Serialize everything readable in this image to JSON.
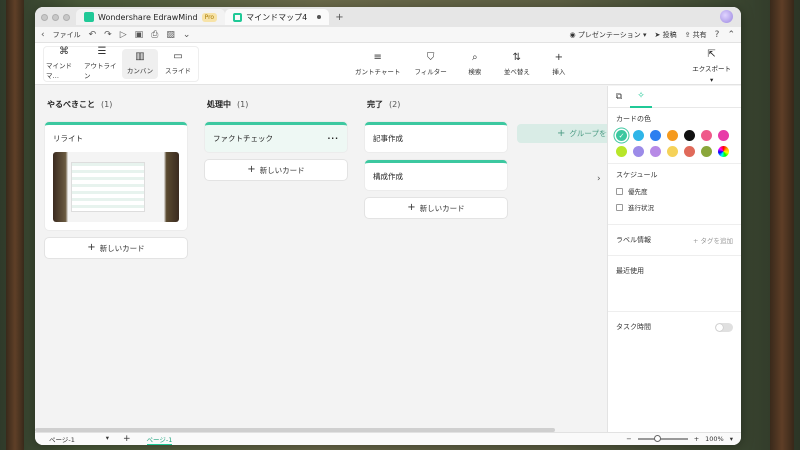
{
  "window": {
    "tabs": [
      {
        "label": "Wondershare EdrawMind",
        "badge": "Pro"
      },
      {
        "label": "マインドマップ4"
      }
    ]
  },
  "menubar": {
    "file_label": "ファイル",
    "present_label": "プレゼンテーション",
    "post_label": "投稿",
    "share_label": "共有"
  },
  "toolbar": {
    "views": [
      {
        "label": "マインドマ…",
        "icon": "mindmap-icon"
      },
      {
        "label": "アウトライン",
        "icon": "outline-icon"
      },
      {
        "label": "カンバン",
        "icon": "kanban-icon"
      },
      {
        "label": "スライド",
        "icon": "slide-icon"
      }
    ],
    "tools": [
      {
        "label": "ガントチャート"
      },
      {
        "label": "フィルター"
      },
      {
        "label": "検索"
      },
      {
        "label": "並べ替え"
      },
      {
        "label": "挿入"
      }
    ],
    "export_label": "エクスポート"
  },
  "board": {
    "columns": [
      {
        "title": "やるべきこと",
        "count": "(1)",
        "cards": [
          "リライト"
        ]
      },
      {
        "title": "処理中",
        "count": "(1)",
        "cards": [
          "ファクトチェック"
        ]
      },
      {
        "title": "完了",
        "count": "(2)",
        "cards": [
          "記事作成",
          "構成作成"
        ]
      }
    ],
    "new_card_label": "新しいカード",
    "add_group_label": "グループを追"
  },
  "panel": {
    "card_color_title": "カードの色",
    "colors": [
      "#3cc8a0",
      "#2fb5e8",
      "#2d7ff0",
      "#f59a1e",
      "#111111",
      "#ef5a8a",
      "#e83aa8",
      "#b8e62a",
      "#9c8be8",
      "#b78ae6",
      "#f5d259",
      "#e06a5a",
      "#8aa63a",
      "#rainbow"
    ],
    "schedule_title": "スケジュール",
    "priority_label": "優先度",
    "progress_label": "進行状況",
    "label_info_title": "ラベル情報",
    "add_tag_label": "タグを追加",
    "recent_title": "最近使用",
    "task_time_title": "タスク時間"
  },
  "statusbar": {
    "page_select": "ページ-1",
    "page_tab": "ページ-1",
    "zoom": "100%"
  }
}
